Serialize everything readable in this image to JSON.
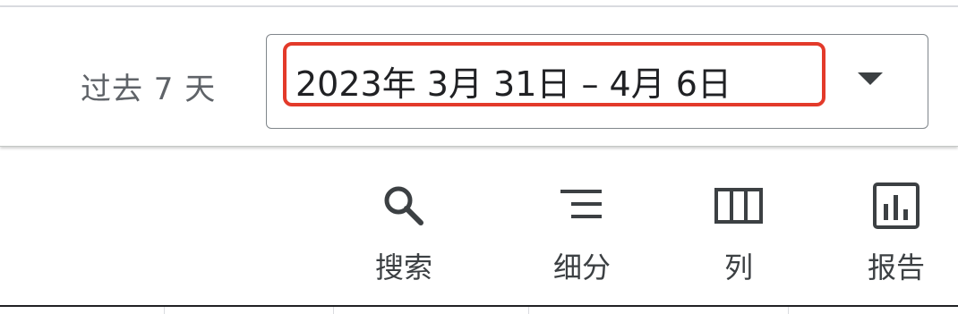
{
  "date_range": {
    "label": "过去 7 天",
    "value": "2023年 3月 31日 – 4月 6日"
  },
  "toolbar": {
    "search_label": "搜索",
    "segment_label": "细分",
    "columns_label": "列",
    "report_label": "报告"
  },
  "colors": {
    "highlight": "#e33a2a",
    "icon": "#3c4043",
    "label_gray": "#5f6368"
  }
}
